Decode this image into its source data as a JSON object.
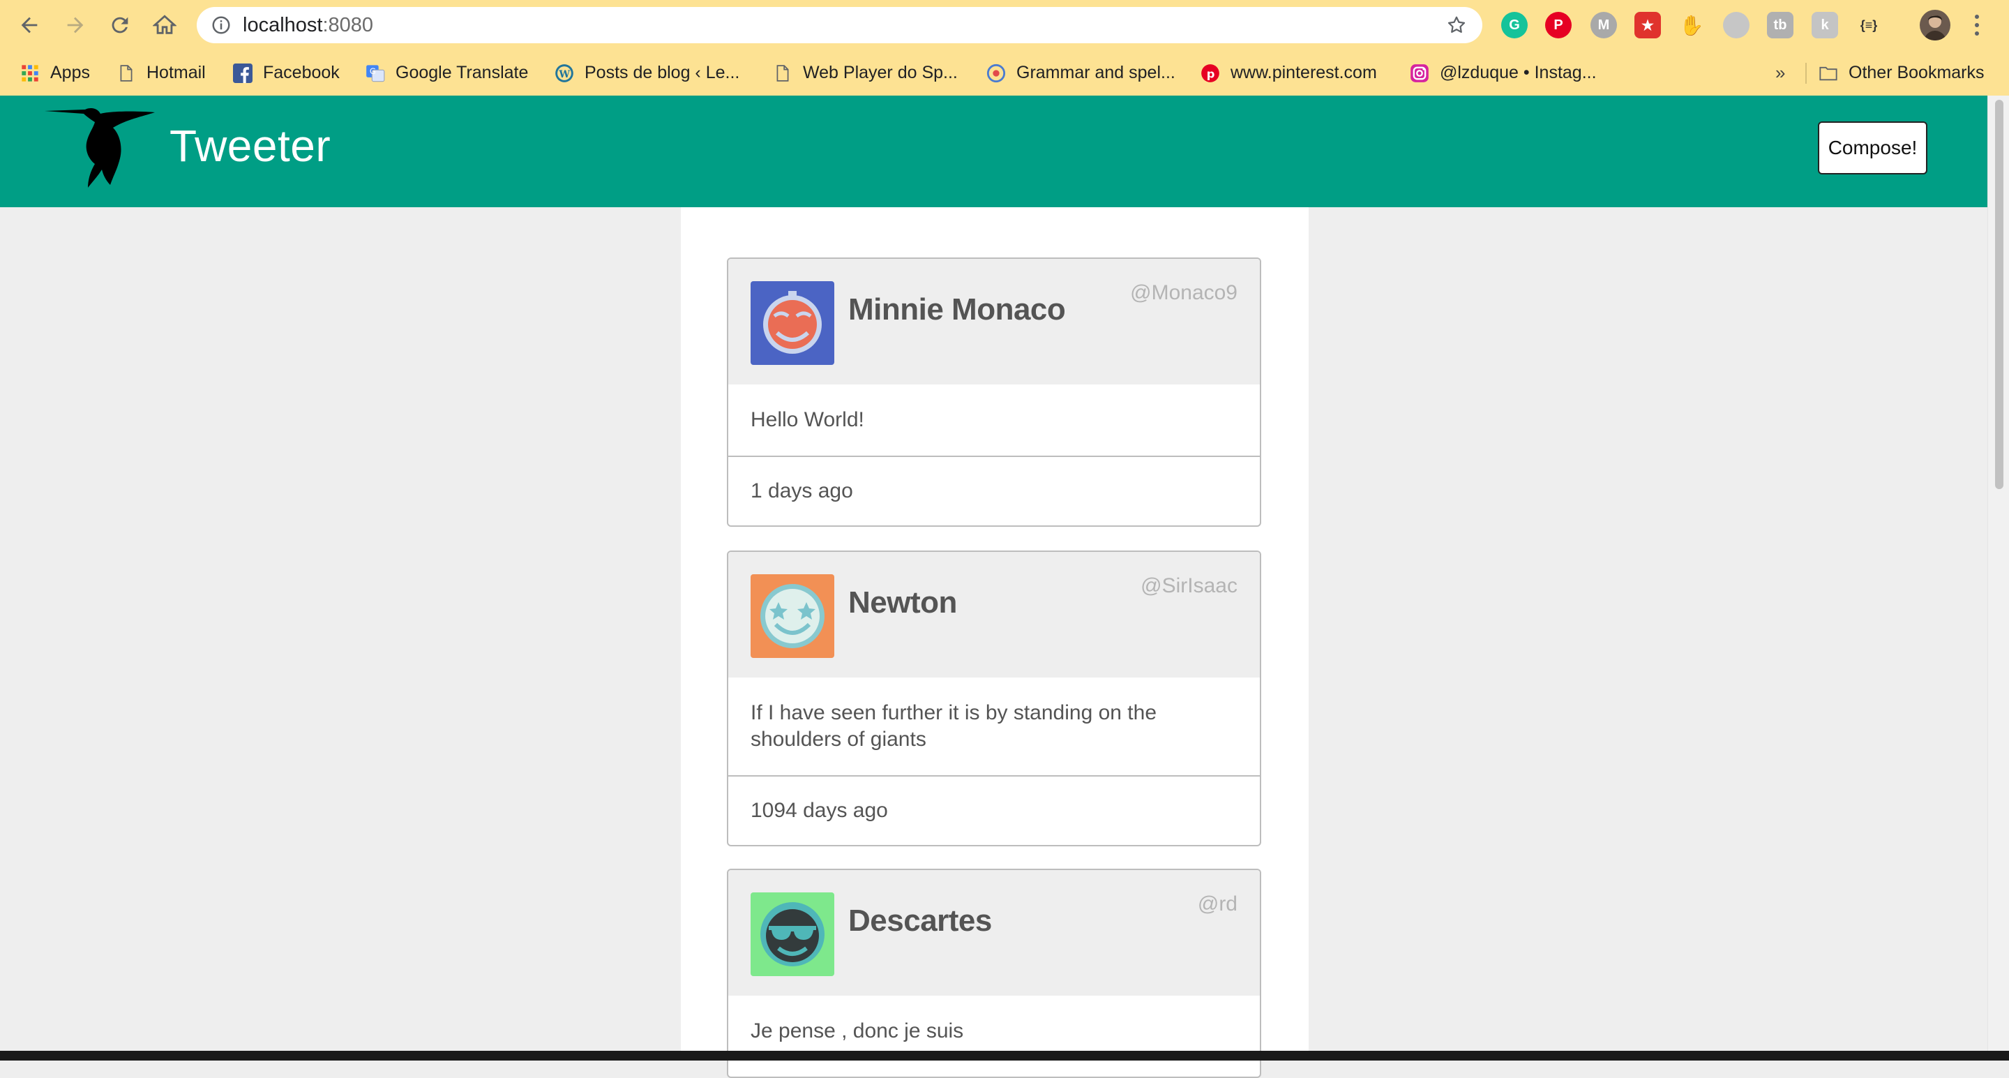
{
  "browser": {
    "url_host": "localhost",
    "url_port": ":8080",
    "bookmarks": [
      {
        "label": "Apps",
        "icon": "apps-grid-icon"
      },
      {
        "label": "Hotmail",
        "icon": "page-icon"
      },
      {
        "label": "Facebook",
        "icon": "facebook-icon"
      },
      {
        "label": "Google Translate",
        "icon": "translate-icon"
      },
      {
        "label": "Posts de blog ‹ Le...",
        "icon": "wordpress-icon"
      },
      {
        "label": "Web Player do Sp...",
        "icon": "page-icon"
      },
      {
        "label": "Grammar and spel...",
        "icon": "grammar-icon"
      },
      {
        "label": "www.pinterest.com",
        "icon": "pinterest-icon"
      },
      {
        "label": "@lzduque • Instag...",
        "icon": "instagram-icon"
      }
    ],
    "more_label": "»",
    "other_bookmarks": "Other Bookmarks"
  },
  "site": {
    "title": "Tweeter",
    "compose_label": "Compose!"
  },
  "tweets": [
    {
      "name": "Minnie Monaco",
      "handle": "@Monaco9",
      "text": "Hello World!",
      "time": "1 days ago",
      "avatar_bg": "#4b64c4"
    },
    {
      "name": "Newton",
      "handle": "@SirIsaac",
      "text": "If I have seen further it is by standing on the shoulders of giants",
      "time": "1094 days ago",
      "avatar_bg": "#f29055"
    },
    {
      "name": "Descartes",
      "handle": "@rd",
      "text": "Je pense , donc je suis",
      "time": "",
      "avatar_bg": "#7ee88c"
    }
  ],
  "colors": {
    "header_bg": "#009e85",
    "chrome_bg": "#fde293",
    "page_bg": "#eeeeee"
  }
}
